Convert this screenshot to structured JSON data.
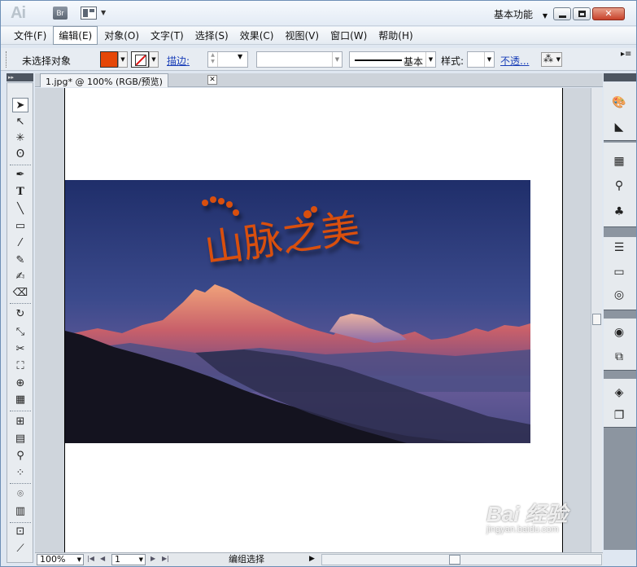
{
  "app": {
    "logo": "Ai",
    "bridge_label": "Br",
    "workspace": "基本功能",
    "close_label": "✕"
  },
  "menu": [
    "文件(F)",
    "编辑(E)",
    "对象(O)",
    "文字(T)",
    "选择(S)",
    "效果(C)",
    "视图(V)",
    "窗口(W)",
    "帮助(H)"
  ],
  "control": {
    "selection": "未选择对象",
    "fill_color": "#e54708",
    "stroke_label": "描边:",
    "stroke_profile": "基本",
    "style_label": "样式:",
    "opacity_label": "不透..."
  },
  "document": {
    "tab_title": "1.jpg* @ 100% (RGB/预览)",
    "image_text": "山脉之美",
    "text_color": "#d9500f"
  },
  "status": {
    "zoom": "100%",
    "page": "1",
    "mode": "编组选择"
  },
  "watermark": {
    "main": "Bai 经验",
    "sub": "jingyan.baidu.com"
  }
}
